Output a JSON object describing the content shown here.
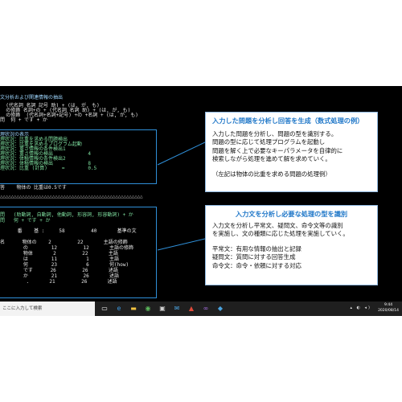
{
  "console": {
    "header": "文分析および関連情報の抽出",
    "lines_top": [
      "  (代名詞 名詞 記号 助) + (は, が, も)",
      "  の修飾 名詞+の + (代名詞 名詞 助) + (は, が, も)",
      "  の修飾  (代名詞+名詞+記号) +の +名詞 + (は, が, も)",
      "問  何 + です + か"
    ],
    "box1_lines": [
      "理状況の表示",
      "理状況：比重を求める問題検出",
      "理状況：比重を求めるプログラム起動",
      "理状況：重さ情報の条件検出1",
      "理状況：重さ情報の検出            4",
      "理状況：体積情報の条件検出2",
      "理状況：体積情報の検出            8",
      "理状況：比重 (計算)     =        0.5"
    ],
    "answer_line": "答    物体の 比重は0.5です",
    "separator": "△△△△△△△△△△△△△△△△△△△△△△△△△△△△△△△△△△△△△△△△△△△△△△△△△△△△",
    "box2_lines": [
      "問   (助動詞, 自動詞, 他動詞, 形容詞, 形容動詞) + か",
      "問   何 + です + か",
      "",
      "      番    基 :     58         40       基準の文",
      "",
      "名      物体の    2         22       主語の修飾",
      "        の        12         12       主語の修飾",
      "        物体       2         22       主語",
      "        は        11          1       主語",
      "        何        23          6       何(how)",
      "        です      26         26       述語",
      "        か        21         26       述語",
      "         .       21         26       述語"
    ]
  },
  "callouts": [
    {
      "title": "入力した問題を分析し回答を生成（数式処理の例）",
      "body": [
        "入力した問題を分析し、問題の型を識別する。",
        "問題の型に応じて処理プログラムを起動し",
        "問題を解く上で必要なキーパラメータを自律的に",
        "検索しながら処理を進めて解を求めていく。"
      ],
      "note": "（左記は物体の比重を求める問題の処理例）"
    },
    {
      "title": "入力文を分析し必要な処理の型を識別",
      "body": [
        "入力文を分析し平常文、疑問文、命令文等の識別",
        "を実施し、文の種類に応じた処理を実施していく。"
      ],
      "items": [
        "平常文：有用な情報の抽出と記録",
        "疑問文：質問に対する回答生成",
        "命令文：命令・依頼に対する対応"
      ]
    }
  ],
  "taskbar": {
    "search_text": "ここに入力して検索",
    "icons": [
      "task-view-icon",
      "edge-icon",
      "explorer-icon",
      "chrome-icon",
      "store-icon",
      "mail-icon",
      "acrobat-icon",
      "visual-studio-icon",
      "app-icon"
    ],
    "time": "9:44",
    "date": "2020/08/14"
  },
  "colors": {
    "accent_blue": "#1f77c8",
    "frame_blue": "#2f8fd8",
    "console_bg": "#000000"
  }
}
